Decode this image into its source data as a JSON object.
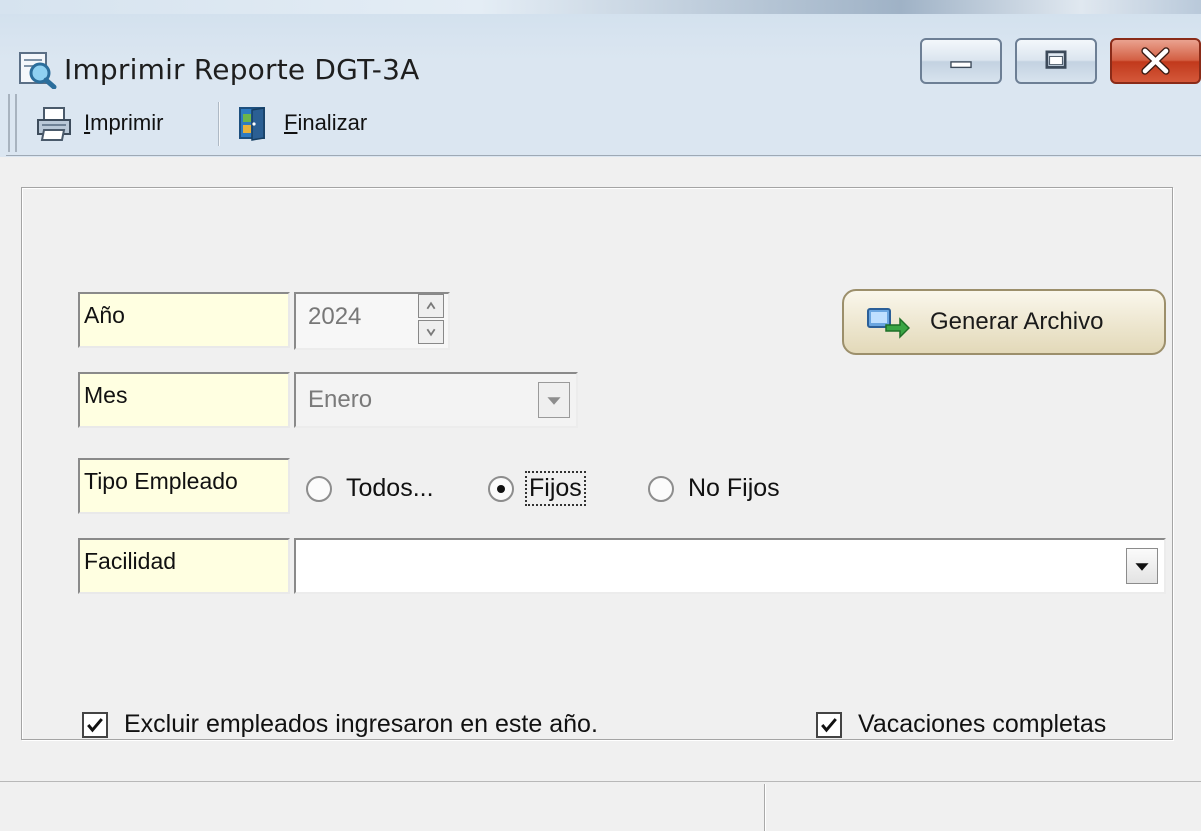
{
  "window": {
    "title": "Imprimir Reporte DGT-3A",
    "controls": {
      "minimize": "minimize",
      "maximize": "maximize",
      "close": "close"
    }
  },
  "toolbar": {
    "print_label_accel": "I",
    "print_label_rest": "mprimir",
    "finish_label_accel": "F",
    "finish_label_rest": "inalizar"
  },
  "form": {
    "year_label": "Año",
    "year_value": "2024",
    "month_label": "Mes",
    "month_value": "Enero",
    "employee_type_label": "Tipo Empleado",
    "employee_type_options": [
      {
        "label": "Todos...",
        "selected": false
      },
      {
        "label": "Fijos",
        "selected": true
      },
      {
        "label": "No Fijos",
        "selected": false
      }
    ],
    "facility_label": "Facilidad",
    "facility_value": "",
    "generate_button_label": "Generar Archivo",
    "exclude_checkbox_label": "Excluir empleados ingresaron en este año.",
    "exclude_checked": true,
    "vacations_checkbox_label": "Vacaciones completas",
    "vacations_checked": true
  },
  "statusbar": {
    "left": "",
    "right": ""
  },
  "colors": {
    "label_bg": "#ffffe1",
    "close_button": "#c1391c",
    "generate_button": "#ede6cf"
  }
}
